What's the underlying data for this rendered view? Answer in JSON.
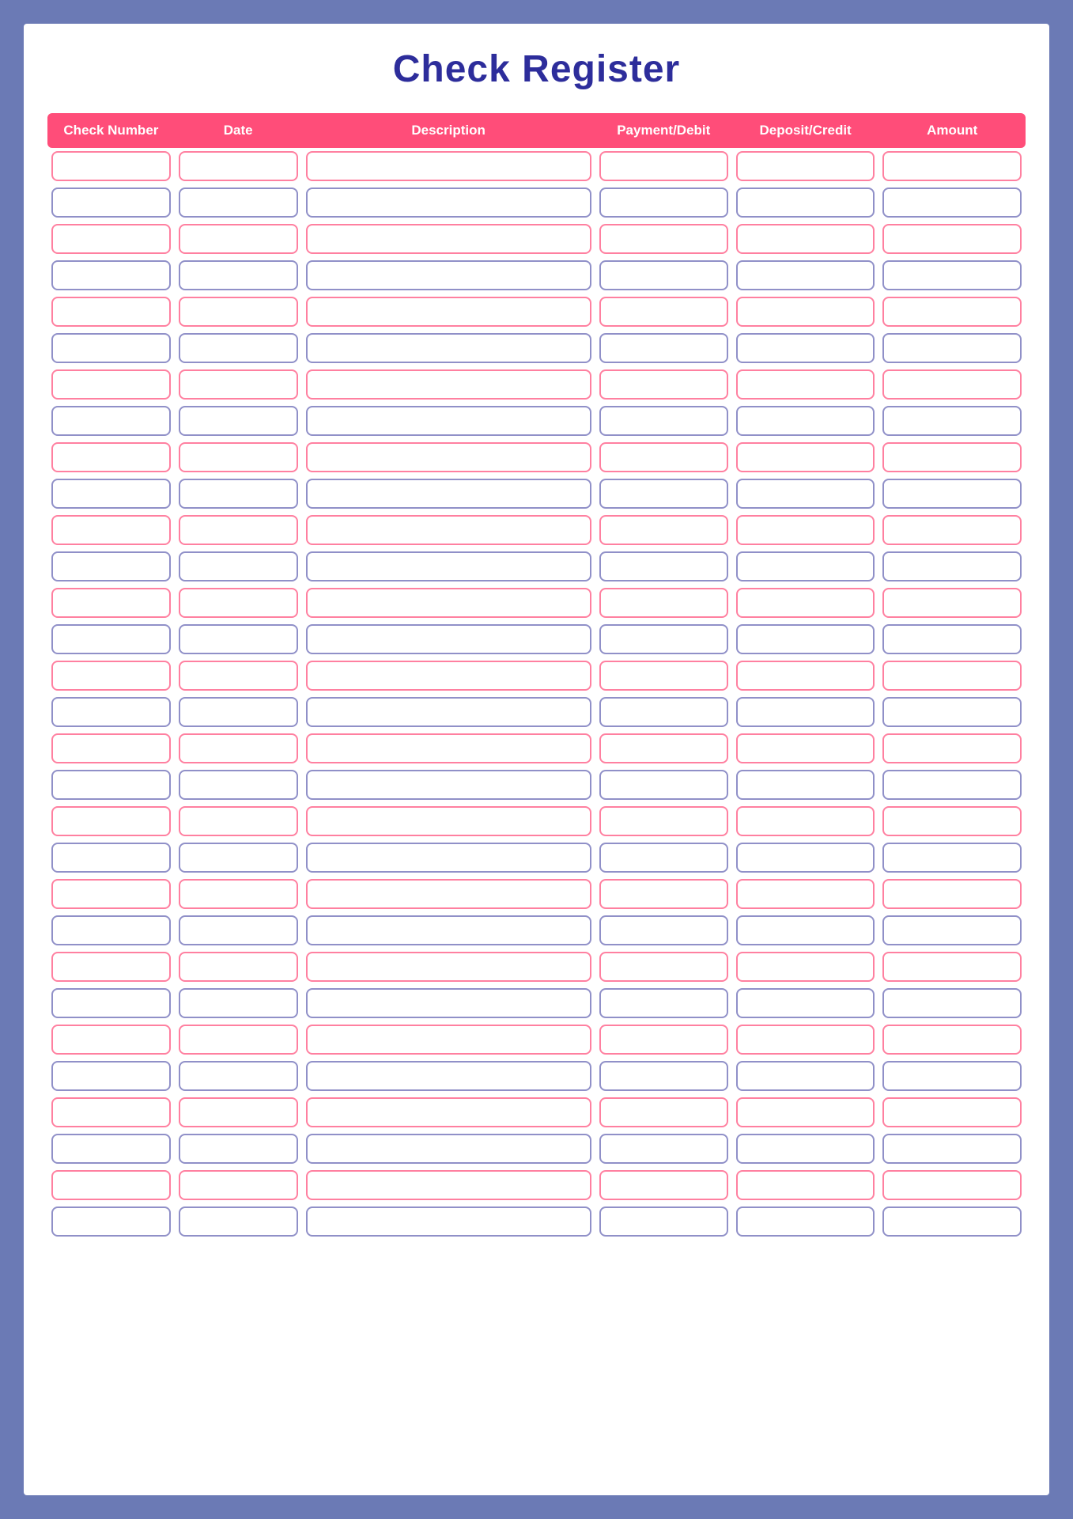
{
  "page": {
    "title": "Check Register",
    "header": {
      "columns": [
        {
          "key": "check_number",
          "label": "Check Number"
        },
        {
          "key": "date",
          "label": "Date"
        },
        {
          "key": "description",
          "label": "Description"
        },
        {
          "key": "payment_debit",
          "label": "Payment/Debit"
        },
        {
          "key": "deposit_credit",
          "label": "Deposit/Credit"
        },
        {
          "key": "amount",
          "label": "Amount"
        }
      ]
    },
    "row_count": 30
  }
}
